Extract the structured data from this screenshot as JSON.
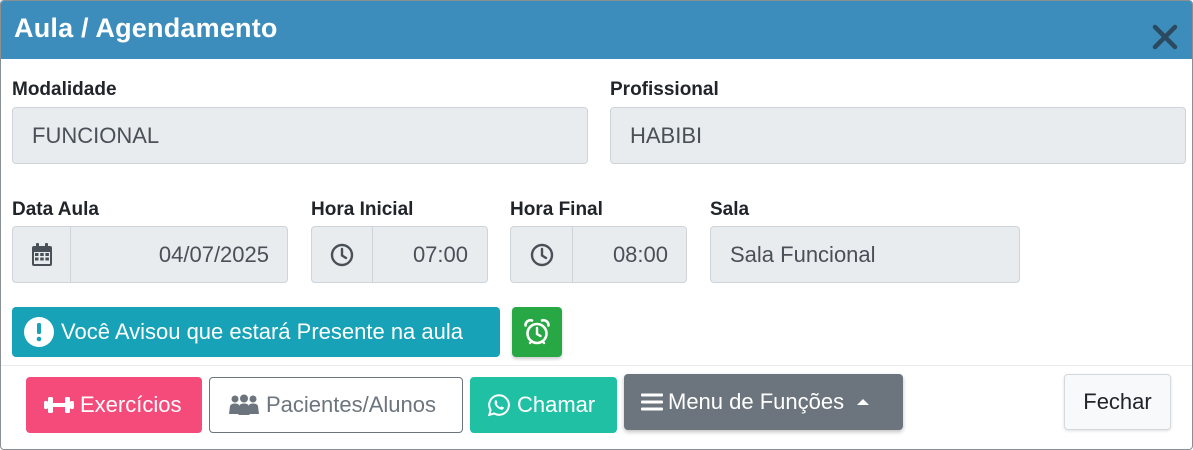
{
  "window": {
    "title": "Aula / Agendamento"
  },
  "form": {
    "modalidade": {
      "label": "Modalidade",
      "value": "FUNCIONAL"
    },
    "profissional": {
      "label": "Profissional",
      "value": "HABIBI"
    },
    "data_aula": {
      "label": "Data Aula",
      "value": "04/07/2025",
      "icon": "calendar-icon"
    },
    "hora_inicial": {
      "label": "Hora Inicial",
      "value": "07:00",
      "icon": "clock-icon"
    },
    "hora_final": {
      "label": "Hora Final",
      "value": "08:00",
      "icon": "clock-icon"
    },
    "sala": {
      "label": "Sala",
      "value": "Sala Funcional"
    }
  },
  "presence": {
    "label": "Você Avisou que estará Presente na aula",
    "icon": "info-circle-icon",
    "color": "#17a2b8"
  },
  "alarm": {
    "icon": "alarm-clock-icon",
    "color": "#28a745"
  },
  "footer": {
    "exercicios": {
      "label": "Exercícios",
      "icon": "dumbbell-icon",
      "color": "#f44b7b"
    },
    "pacientes": {
      "label": "Pacientes/Alunos",
      "icon": "users-icon"
    },
    "chamar": {
      "label": "Chamar",
      "icon": "whatsapp-icon",
      "color": "#20c0a5"
    },
    "menu": {
      "label": "Menu de Funções",
      "icon": "bars-icon",
      "caret": "caret-up-icon",
      "color": "#6c757d"
    },
    "fechar": {
      "label": "Fechar"
    }
  },
  "colors": {
    "header": "#3c8dbc",
    "readonly_bg": "#e9ecef"
  }
}
